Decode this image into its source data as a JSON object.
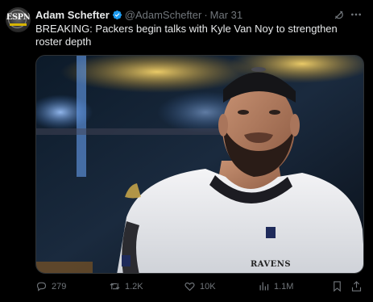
{
  "author": {
    "display_name": "Adam Schefter",
    "handle": "@AdamSchefter",
    "separator": "·",
    "date": "Mar 31",
    "avatar_text": "ESPN"
  },
  "tweet": {
    "text": "BREAKING: Packers begin talks with Kyle Van Noy to strengthen roster depth"
  },
  "media": {
    "jersey_text": "RAVENS"
  },
  "actions": {
    "replies": "279",
    "reposts": "1.2K",
    "likes": "10K",
    "views": "1.1M"
  },
  "colors": {
    "background": "#000000",
    "text": "#e7e9ea",
    "muted": "#71767b",
    "verified": "#1d9bf0"
  },
  "icons": [
    "verified-badge-icon",
    "grok-icon",
    "more-icon",
    "reply-icon",
    "repost-icon",
    "like-icon",
    "views-icon",
    "bookmark-icon",
    "share-icon"
  ]
}
